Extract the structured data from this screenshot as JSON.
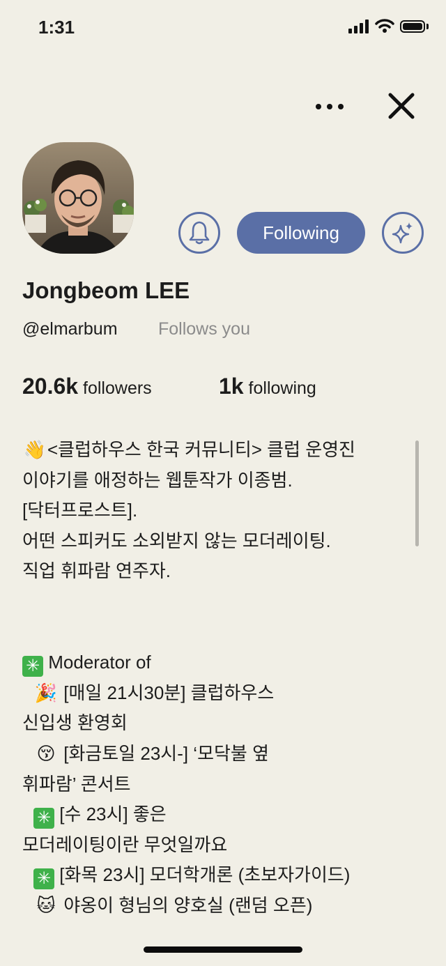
{
  "status_bar": {
    "time": "1:31"
  },
  "profile": {
    "name": "Jongbeom LEE",
    "handle": "@elmarbum",
    "follows_you": "Follows you",
    "followers_count": "20.6k",
    "followers_label": "followers",
    "following_count": "1k",
    "following_label": "following"
  },
  "actions": {
    "follow_label": "Following"
  },
  "bio": {
    "lines": [
      "<클럽하우스 한국 커뮤니티> 클럽 운영진",
      "이야기를 애정하는 웹툰작가 이종범.",
      "[닥터프로스트].",
      "어떤 스피커도 소외받지 않는 모더레이팅.",
      "직업 휘파람 연주자.",
      "",
      "",
      "Moderator of",
      "[매일 21시30분] 클럽하우스",
      "신입생 환영회",
      "[화금토일 23시-] ‘모닥불 옆",
      "휘파람’ 콘서트",
      "[수 23시] 좋은",
      "모더레이팅이란 무엇일까요",
      "[화목 23시] 모더학개론 (초보자가이드)",
      "야옹이 형님의 양호실 (랜덤 오픈)"
    ]
  },
  "colors": {
    "background": "#f1efe6",
    "accent": "#5a6fa6",
    "muted": "#8b8b8b"
  },
  "icons": [
    "waving-hand-icon",
    "eight-spoked-asterisk-icon",
    "party-popper-icon",
    "kissing-face-icon",
    "cat-face-icon"
  ]
}
